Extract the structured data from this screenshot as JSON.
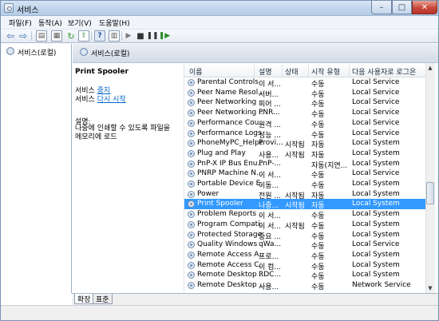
{
  "window": {
    "title": "서비스",
    "minimize": "–",
    "maximize": "□",
    "close": "✕"
  },
  "menu": [
    "파일(F)",
    "동작(A)",
    "보기(V)",
    "도움말(H)"
  ],
  "toolbar_icons": [
    "back-arrow-icon",
    "forward-arrow-icon",
    "show-hide-tree-icon",
    "properties-icon",
    "refresh-icon",
    "export-icon",
    "help-icon",
    "properties-sheet-icon",
    "start-icon",
    "stop-icon",
    "pause-icon",
    "restart-icon"
  ],
  "tree": {
    "label": "서비스(로컬)"
  },
  "pane_header": {
    "title": "서비스(로컬)"
  },
  "detail": {
    "service_name": "Print Spooler",
    "action1_prefix": "서비스 ",
    "action1_link": "중지",
    "action2_prefix": "서비스 ",
    "action2_link": "다시 시작",
    "desc_label": "설명:",
    "desc_text": "나중에 인쇄할 수 있도록 파일을 메모리에 로드"
  },
  "columns": [
    "이름",
    "설명",
    "상태",
    "시작 유형",
    "다음 사용자로 로그온"
  ],
  "rows": [
    {
      "name": "Parental Controls",
      "desc": "이 서...",
      "status": "",
      "startup": "수동",
      "logon": "Local Service"
    },
    {
      "name": "Peer Name Resol...",
      "desc": "서버...",
      "status": "",
      "startup": "수동",
      "logon": "Local Service"
    },
    {
      "name": "Peer Networking ...",
      "desc": "피어 ...",
      "status": "",
      "startup": "수동",
      "logon": "Local Service"
    },
    {
      "name": "Peer Networking I...",
      "desc": "PNR...",
      "status": "",
      "startup": "수동",
      "logon": "Local Service"
    },
    {
      "name": "Performance Cou...",
      "desc": "원격 ...",
      "status": "",
      "startup": "수동",
      "logon": "Local Service"
    },
    {
      "name": "Performance Logs...",
      "desc": "성능 ...",
      "status": "",
      "startup": "수동",
      "logon": "Local Service"
    },
    {
      "name": "PhoneMyPC_Helper",
      "desc": "Provi...",
      "status": "시작됨",
      "startup": "자동",
      "logon": "Local System"
    },
    {
      "name": "Plug and Play",
      "desc": "사용...",
      "status": "시작됨",
      "startup": "자동",
      "logon": "Local System"
    },
    {
      "name": "PnP-X IP Bus Enu...",
      "desc": "PnP-...",
      "status": "",
      "startup": "자동(지연...",
      "logon": "Local System"
    },
    {
      "name": "PNRP Machine N...",
      "desc": "이 서...",
      "status": "",
      "startup": "수동",
      "logon": "Local Service"
    },
    {
      "name": "Portable Device E...",
      "desc": "이동...",
      "status": "",
      "startup": "수동",
      "logon": "Local System"
    },
    {
      "name": "Power",
      "desc": "전원 ...",
      "status": "시작됨",
      "startup": "자동",
      "logon": "Local System"
    },
    {
      "name": "Print Spooler",
      "desc": "나중...",
      "status": "시작됨",
      "startup": "자동",
      "logon": "Local System",
      "selected": true
    },
    {
      "name": "Problem Reports ...",
      "desc": "이 서...",
      "status": "",
      "startup": "수동",
      "logon": "Local System"
    },
    {
      "name": "Program Compati...",
      "desc": "이 서...",
      "status": "시작됨",
      "startup": "수동",
      "logon": "Local System"
    },
    {
      "name": "Protected Storage",
      "desc": "중요 ...",
      "status": "",
      "startup": "수동",
      "logon": "Local System"
    },
    {
      "name": "Quality Windows ...",
      "desc": "qWa...",
      "status": "",
      "startup": "수동",
      "logon": "Local Service"
    },
    {
      "name": "Remote Access A...",
      "desc": "프로...",
      "status": "",
      "startup": "수동",
      "logon": "Local System"
    },
    {
      "name": "Remote Access C...",
      "desc": "이 컴...",
      "status": "",
      "startup": "수동",
      "logon": "Local System"
    },
    {
      "name": "Remote Desktop ...",
      "desc": "RDC...",
      "status": "",
      "startup": "수동",
      "logon": "Local System"
    },
    {
      "name": "Remote Desktop ...",
      "desc": "사용...",
      "status": "",
      "startup": "수동",
      "logon": "Network Service"
    }
  ],
  "tabs": [
    "확장",
    "표준"
  ]
}
